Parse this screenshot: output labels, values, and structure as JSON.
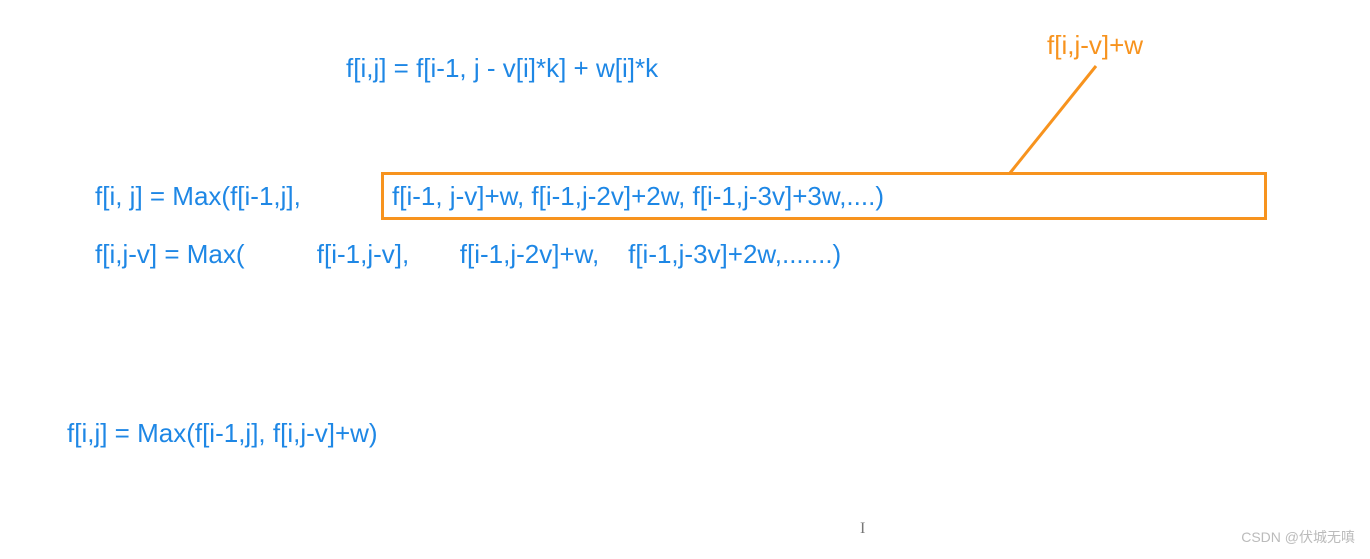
{
  "annotation": {
    "label": "f[i,j-v]+w"
  },
  "formulas": {
    "line1": "f[i,j] = f[i-1, j - v[i]*k] + w[i]*k",
    "line2_left": "f[i, j] = Max(f[i-1,j],",
    "line2_boxed": "f[i-1, j-v]+w, f[i-1,j-2v]+2w, f[i-1,j-3v]+3w,....)",
    "line3": "f[i,j-v] = Max(          f[i-1,j-v],       f[i-1,j-2v]+w,    f[i-1,j-3v]+2w,.......)",
    "line4": "f[i,j] = Max(f[i-1,j], f[i,j-v]+w)"
  },
  "watermark": "CSDN @伏城无嗔",
  "cursor": "I"
}
